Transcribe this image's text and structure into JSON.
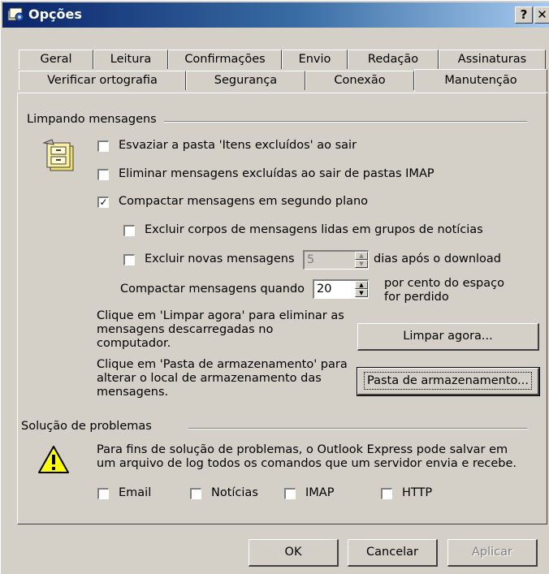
{
  "window": {
    "title": "Opções",
    "help_label": "?",
    "close_label": "✕"
  },
  "tabs_row1": [
    "Geral",
    "Leitura",
    "Confirmações",
    "Envio",
    "Redação",
    "Assinaturas"
  ],
  "tabs_row2": [
    "Verificar ortografia",
    "Segurança",
    "Conexão",
    "Manutenção"
  ],
  "active_tab": "Manutenção",
  "cleaning": {
    "group_label": "Limpando mensagens",
    "empty_deleted": {
      "label": "Esvaziar a pasta 'Itens excluídos' ao sair",
      "checked": false
    },
    "purge_imap": {
      "label": "Eliminar mensagens excluídas ao sair de pastas IMAP",
      "checked": false
    },
    "compact_background": {
      "label": "Compactar mensagens em segundo plano",
      "checked": true
    },
    "delete_read_bodies": {
      "label": "Excluir corpos de mensagens lidas em grupos de notícias",
      "checked": false
    },
    "delete_news": {
      "label_before": "Excluir novas mensagens",
      "days_value": "5",
      "label_after": "dias após o download",
      "checked": false
    },
    "compact_when": {
      "label": "Compactar mensagens quando",
      "percent_value": "20",
      "label_after_1": "por cento do espaço",
      "label_after_2": "for perdido"
    },
    "clean_text": [
      "Clique em 'Limpar agora' para eliminar as",
      "mensagens descarregadas no",
      "computador."
    ],
    "clean_button": "Limpar agora...",
    "store_text": [
      "Clique em 'Pasta de armazenamento' para",
      "alterar o local de armazenamento das",
      "mensagens."
    ],
    "store_button": "Pasta de armazenamento..."
  },
  "troubleshooting": {
    "group_label": "Solução de problemas",
    "text": [
      "Para fins de solução de problemas, o Outlook Express pode salvar em",
      "um arquivo de log todos os comandos que um servidor envia e recebe."
    ],
    "options": [
      {
        "label": "Email",
        "checked": false
      },
      {
        "label": "Notícias",
        "checked": false
      },
      {
        "label": "IMAP",
        "checked": false
      },
      {
        "label": "HTTP",
        "checked": false
      }
    ]
  },
  "buttons": {
    "ok": "OK",
    "cancel": "Cancelar",
    "apply": "Aplicar"
  },
  "icons": {
    "title": "options-icon",
    "cleaning": "file-cabinet-icon",
    "warning": "warning-icon"
  },
  "colors": {
    "face": "#d4d0c8",
    "title_start": "#0a246a",
    "title_end": "#a6caf0",
    "warning": "#ffff00"
  }
}
